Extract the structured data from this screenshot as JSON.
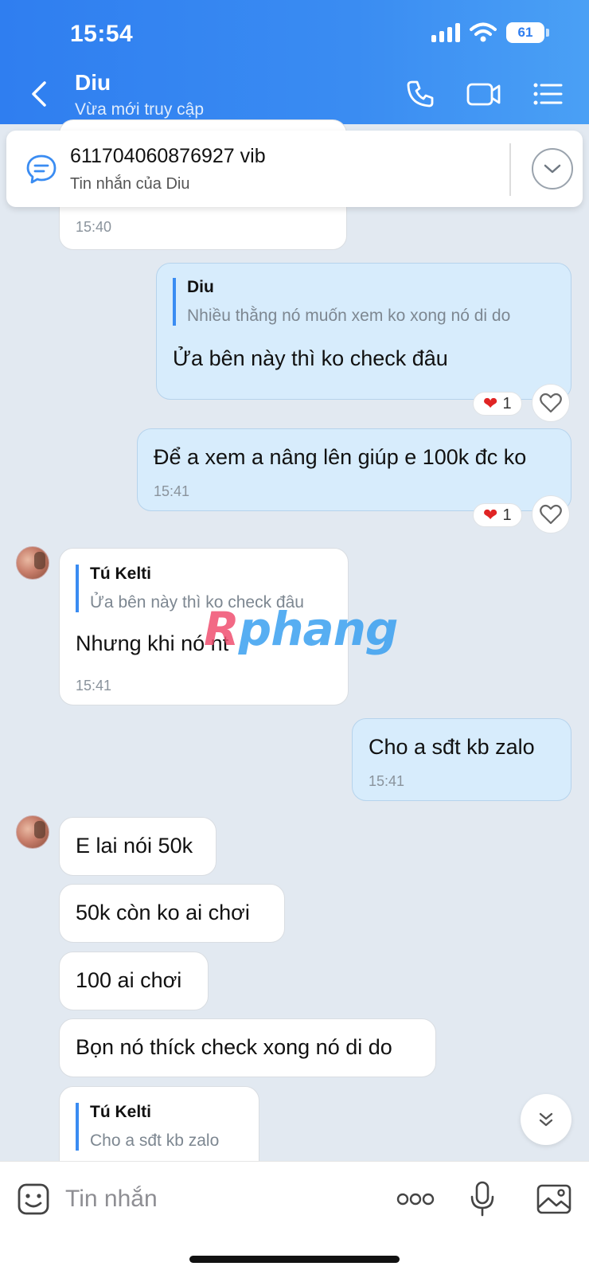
{
  "status_bar": {
    "time": "15:54",
    "battery": "61"
  },
  "header": {
    "contact_name": "Diu",
    "contact_status": "Vừa mới truy cập",
    "icons": [
      "back-icon",
      "phone-icon",
      "video-icon",
      "menu-list-icon"
    ]
  },
  "pinned": {
    "text": "611704060876927 vib",
    "subtitle": "Tin nhắn của Diu"
  },
  "messages": [
    {
      "time": "15:40"
    },
    {
      "quote_author": "Diu",
      "quote_text": "Nhiều thằng nó muốn xem ko xong nó di do",
      "text": "Ửa bên này thì ko check đâu",
      "reaction_count": "1"
    },
    {
      "text": "Để a xem a nâng lên giúp e 100k đc ko",
      "time": "15:41",
      "reaction_count": "1"
    },
    {
      "quote_author": "Tú Kelti",
      "quote_text": "Ửa bên này thì ko check đâu",
      "text": "Nhưng khi nó nt",
      "time": "15:41"
    },
    {
      "text": "Cho a sđt kb zalo",
      "time": "15:41"
    },
    {
      "text": "E lai nói 50k"
    },
    {
      "text": "50k còn ko ai chơi"
    },
    {
      "text": "100 ai chơi"
    },
    {
      "text": "Bọn nó thíck check xong nó di do"
    },
    {
      "quote_author": "Tú Kelti",
      "quote_text": "Cho a sđt kb zalo"
    }
  ],
  "watermark": {
    "first": "R",
    "rest": "phang"
  },
  "input": {
    "placeholder": "Tin nhắn"
  },
  "colors": {
    "header": "#2f7ef0",
    "outgoing": "#d7ecfc",
    "incoming": "#ffffff",
    "background": "#e2e9f1"
  }
}
